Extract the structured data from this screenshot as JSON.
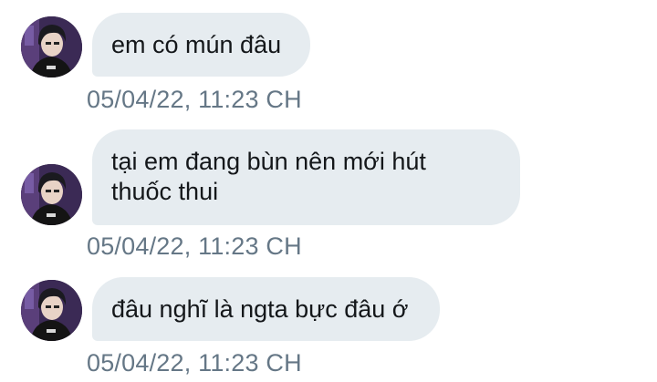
{
  "messages": [
    {
      "text": "em có mún đâu",
      "timestamp": "05/04/22, 11:23 CH"
    },
    {
      "text": "tại em đang bùn nên mới hút\nthuốc thui",
      "timestamp": "05/04/22, 11:23 CH"
    },
    {
      "text": "đâu nghĩ là ngta bực đâu ớ",
      "timestamp": "05/04/22, 11:23 CH"
    }
  ],
  "colors": {
    "bubble_bg": "#e6ecf0",
    "text": "#14171a",
    "timestamp": "#657786"
  }
}
